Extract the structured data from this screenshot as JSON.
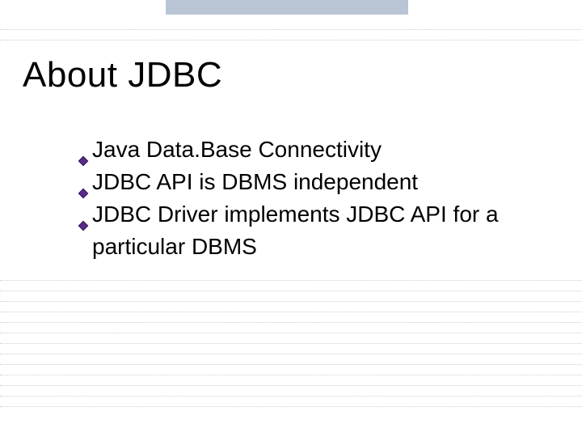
{
  "title": "About JDBC",
  "bullets": {
    "b0": "Java Data.Base Connectivity",
    "b1": "JDBC API is DBMS independent",
    "b2": "JDBC Driver implements JDBC API for a particular DBMS"
  },
  "colors": {
    "bullet_fill": "#5a2a8a",
    "bullet_stroke": "#2e0f55",
    "topbar": "#b9c4d5",
    "dotted": "#cfcfcf"
  }
}
